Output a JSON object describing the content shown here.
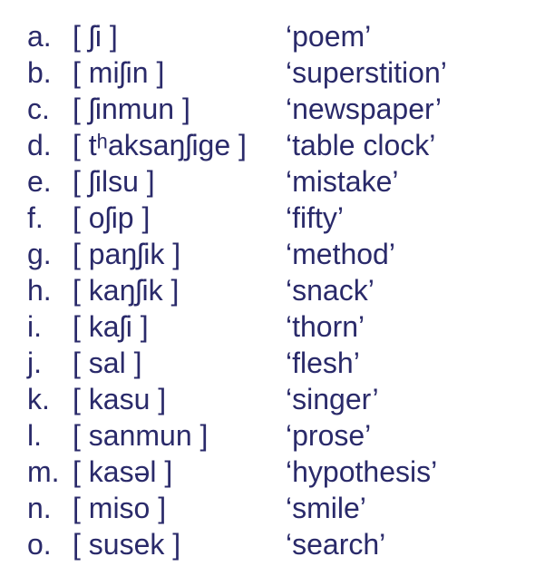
{
  "entries": [
    {
      "label": "a.",
      "ipa": "[ ʃi ]",
      "gloss": "‘poem’"
    },
    {
      "label": "b.",
      "ipa": "[ miʃin ]",
      "gloss": "‘superstition’"
    },
    {
      "label": "c.",
      "ipa": "[ ʃinmun ]",
      "gloss": "‘newspaper’"
    },
    {
      "label": "d.",
      "ipa": "[ tʰaksaŋʃige ]",
      "gloss": "‘table clock’"
    },
    {
      "label": "e.",
      "ipa": "[ ʃilsu ]",
      "gloss": "‘mistake’"
    },
    {
      "label": "f.",
      "ipa": "[ oʃip ]",
      "gloss": "‘fifty’"
    },
    {
      "label": "g.",
      "ipa": "[ paŋʃik ]",
      "gloss": "‘method’"
    },
    {
      "label": "h.",
      "ipa": "[ kaŋʃik ]",
      "gloss": "‘snack’"
    },
    {
      "label": "i.",
      "ipa": "[ kaʃi ]",
      "gloss": "‘thorn’"
    },
    {
      "label": "j.",
      "ipa": "[ sal ]",
      "gloss": "‘flesh’"
    },
    {
      "label": "k.",
      "ipa": "[ kasu ]",
      "gloss": "‘singer’"
    },
    {
      "label": "l.",
      "ipa": "[ sanmun ]",
      "gloss": "‘prose’"
    },
    {
      "label": "m.",
      "ipa": "[ kasəl ]",
      "gloss": "‘hypothesis’"
    },
    {
      "label": "n.",
      "ipa": "[ miso ]",
      "gloss": "‘smile’"
    },
    {
      "label": "o.",
      "ipa": "[ susek ]",
      "gloss": "‘search’"
    }
  ]
}
